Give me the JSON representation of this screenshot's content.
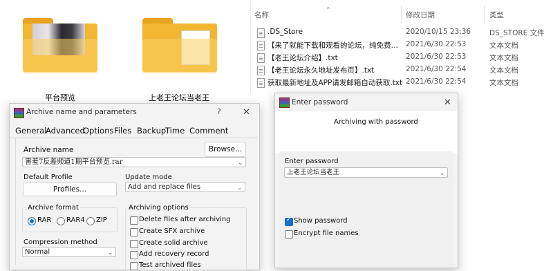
{
  "icon_view": {
    "folders": [
      {
        "label": "平台预览",
        "kind": "photo"
      },
      {
        "label": "上老王论坛当老王",
        "kind": "document"
      }
    ]
  },
  "details_view": {
    "columns": [
      "名称",
      "修改日期",
      "类型"
    ],
    "rows": [
      {
        "name": ".DS_Store",
        "date": "2020/10/15 23:36",
        "type": "DS_STORE 文件"
      },
      {
        "name": "【来了就能下载和观看的论坛，纯免费！…",
        "date": "2021/6/30 22:53",
        "type": "文本文档"
      },
      {
        "name": "【老王论坛介绍】.txt",
        "date": "2021/6/30 22:53",
        "type": "文本文档"
      },
      {
        "name": "【老王论坛永久地址发布页】.txt",
        "date": "2021/6/30 22:54",
        "type": "文本文档"
      },
      {
        "name": "获取最新地址及APP请发邮箱自动获取.txt",
        "date": "2021/6/30 22:54",
        "type": "文本文档"
      }
    ]
  },
  "archive_dialog": {
    "title": "Archive name and parameters",
    "help": "?",
    "close": "✕",
    "tabs": [
      "General",
      "Advanced",
      "Options",
      "Files",
      "Backup",
      "Time",
      "Comment"
    ],
    "archive_name_label": "Archive name",
    "browse_label": "Browse...",
    "archive_name_value": "害羞7反差频道1期平台预览.rar",
    "default_profile_label": "Default Profile",
    "profiles_label": "Profiles...",
    "update_mode_label": "Update mode",
    "update_mode_value": "Add and replace files",
    "archive_format_label": "Archive format",
    "formats": [
      "RAR",
      "RAR4",
      "ZIP"
    ],
    "selected_format": "RAR",
    "archiving_options_label": "Archiving options",
    "options": [
      {
        "label": "Delete files after archiving",
        "checked": false
      },
      {
        "label": "Create SFX archive",
        "checked": false
      },
      {
        "label": "Create solid archive",
        "checked": false
      },
      {
        "label": "Add recovery record",
        "checked": false
      },
      {
        "label": "Test archived files",
        "checked": false
      }
    ],
    "compression_label": "Compression method",
    "compression_value": "Normal"
  },
  "password_dialog": {
    "title": "Enter password",
    "close": "✕",
    "heading": "Archiving with password",
    "enter_label": "Enter password",
    "password_value": "上老王论坛当老王",
    "show_password_label": "Show password",
    "show_password_checked": true,
    "encrypt_names_label": "Encrypt file names",
    "encrypt_names_checked": false
  },
  "colors": {
    "accent": "#1a6fc9",
    "folder": "#f2b630",
    "dialog_bg": "#f3f3f3"
  }
}
